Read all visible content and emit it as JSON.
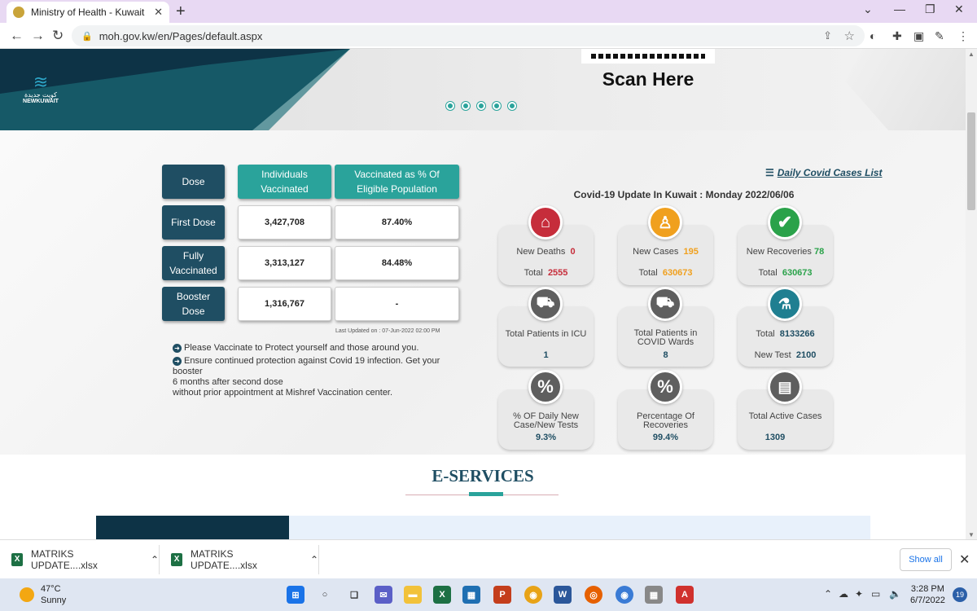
{
  "browser": {
    "tab_title": "Ministry of Health - Kuwait Home",
    "url": "moh.gov.kw/en/Pages/default.aspx"
  },
  "banner": {
    "scan_label": "Scan Here",
    "logo_text": "NEWKUWAIT",
    "logo_arabic": "كويت جديدة",
    "carousel_dots": 5
  },
  "vaccine_table": {
    "headers": [
      "Dose",
      "Individuals Vaccinated",
      "Vaccinated as % Of Eligible Population"
    ],
    "rows": [
      {
        "dose": "First Dose",
        "individuals": "3,427,708",
        "percent": "87.40%"
      },
      {
        "dose": "Fully Vaccinated",
        "individuals": "3,313,127",
        "percent": "84.48%"
      },
      {
        "dose": "Booster Dose",
        "individuals": "1,316,767",
        "percent": "-"
      }
    ],
    "last_updated": "Last Updated on : 07-Jun-2022 02:00 PM",
    "note1": "Please Vaccinate to Protect yourself and those around you.",
    "note2_line1": "Ensure continued protection against Covid 19 infection. Get your booster",
    "note2_line2": "6 months after second dose",
    "note2_line3": "without prior appointment at Mishref Vaccination center."
  },
  "covid": {
    "daily_list_link": "Daily Covid Cases List",
    "title": "Covid-19 Update In Kuwait : Monday 2022/06/06",
    "new_deaths_label": "New Deaths",
    "new_deaths": "0",
    "total_label": "Total",
    "total_deaths": "2555",
    "new_cases_label": "New Cases",
    "new_cases": "195",
    "total_cases": "630673",
    "new_recoveries_label": "New Recoveries",
    "new_recoveries": "78",
    "total_recoveries": "630673",
    "icu_label": "Total Patients in ICU",
    "icu": "1",
    "wards_label": "Total Patients in COVID Wards",
    "wards": "8",
    "total_tests": "8133266",
    "new_test_label": "New Test",
    "new_test": "2100",
    "daily_pct_label": "% OF Daily New Case/New Tests",
    "daily_pct": "9.3%",
    "recovery_pct_label": "Percentage Of Recoveries",
    "recovery_pct": "99.4%",
    "active_label": "Total Active Cases",
    "active": "1309",
    "colors": {
      "deaths": "#c62d3b",
      "cases": "#f0a01e",
      "recoveries": "#2aa24a",
      "dark": "#5f5f5f",
      "teal": "#1f7f91"
    }
  },
  "eservices": {
    "title": "E-SERVICES"
  },
  "downloads": {
    "items": [
      "MATRIKS UPDATE....xlsx",
      "MATRIKS UPDATE....xlsx"
    ],
    "show_all": "Show all"
  },
  "taskbar": {
    "temp": "47°C",
    "condition": "Sunny",
    "time": "3:28 PM",
    "date": "6/7/2022",
    "notifications": "19"
  }
}
